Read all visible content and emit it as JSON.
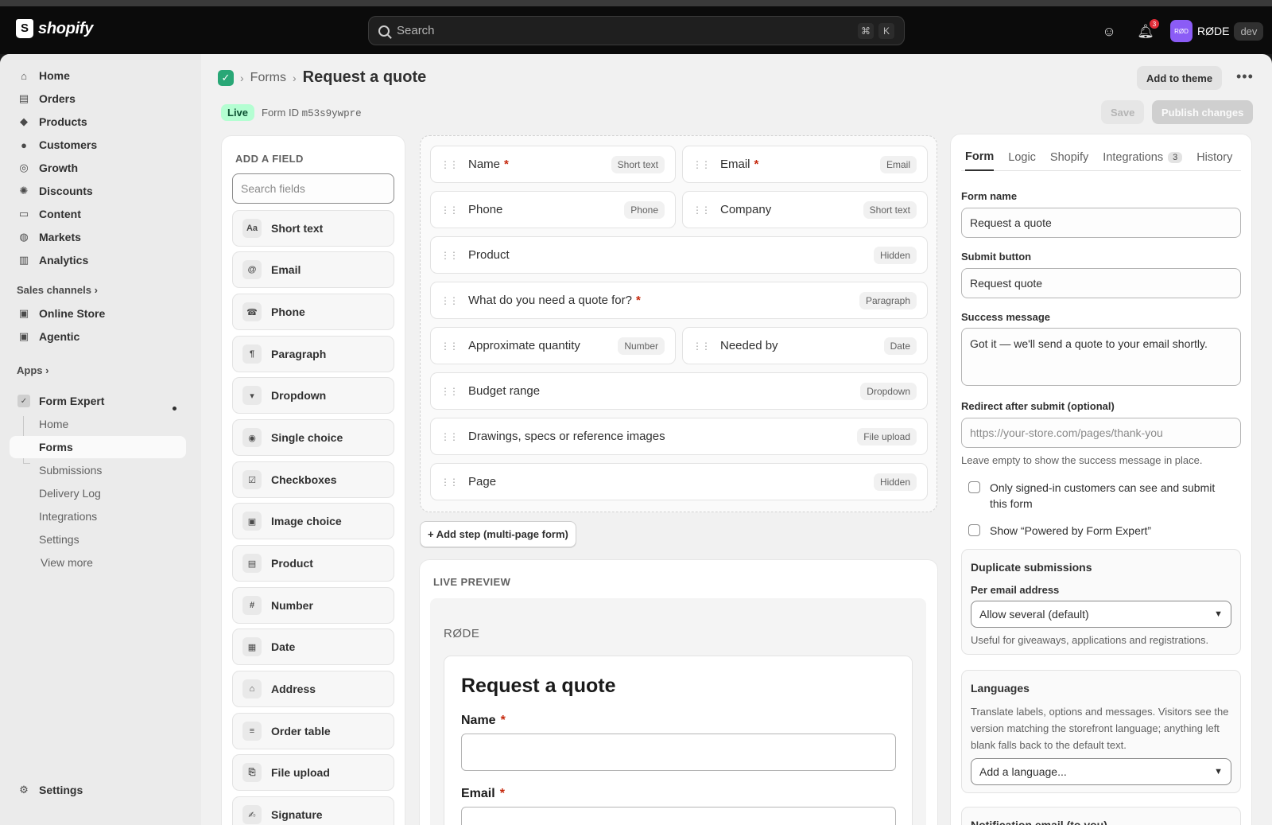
{
  "topbar": {
    "brand": "shopify",
    "search_placeholder": "Search",
    "shortcut_keys": [
      "⌘",
      "K"
    ],
    "notification_count": "3",
    "store_initials": "RØD",
    "store_name": "RØDE",
    "env_badge": "dev"
  },
  "sidebar": {
    "items": [
      {
        "label": "Home",
        "icon": "home-icon"
      },
      {
        "label": "Orders",
        "icon": "inbox-icon"
      },
      {
        "label": "Products",
        "icon": "tag-icon"
      },
      {
        "label": "Customers",
        "icon": "person-icon"
      },
      {
        "label": "Growth",
        "icon": "target-icon"
      },
      {
        "label": "Discounts",
        "icon": "discount-icon"
      },
      {
        "label": "Content",
        "icon": "content-icon"
      },
      {
        "label": "Markets",
        "icon": "globe-icon"
      },
      {
        "label": "Analytics",
        "icon": "bar-chart-icon"
      }
    ],
    "sales_channels_label": "Sales channels",
    "channels": [
      {
        "label": "Online Store",
        "icon": "store-icon"
      },
      {
        "label": "Agentic",
        "icon": "agent-icon"
      }
    ],
    "apps_label": "Apps",
    "app": {
      "label": "Form Expert",
      "icon": "app-check-icon"
    },
    "app_sub": [
      "Home",
      "Forms",
      "Submissions",
      "Delivery Log",
      "Integrations",
      "Settings",
      "View more"
    ],
    "settings_label": "Settings"
  },
  "header": {
    "breadcrumb_parent": "Forms",
    "title": "Request a quote",
    "add_to_theme": "Add to theme",
    "status": "Live",
    "form_id_label": "Form ID",
    "form_id": "m53s9ywpre",
    "save": "Save",
    "publish": "Publish changes"
  },
  "palette": {
    "title": "ADD A FIELD",
    "search_placeholder": "Search fields",
    "items": [
      {
        "glyph": "Aa",
        "label": "Short text"
      },
      {
        "glyph": "@",
        "label": "Email"
      },
      {
        "glyph": "☎",
        "label": "Phone"
      },
      {
        "glyph": "¶",
        "label": "Paragraph"
      },
      {
        "glyph": "▾",
        "label": "Dropdown"
      },
      {
        "glyph": "◉",
        "label": "Single choice"
      },
      {
        "glyph": "☑",
        "label": "Checkboxes"
      },
      {
        "glyph": "▣",
        "label": "Image choice"
      },
      {
        "glyph": "▤",
        "label": "Product"
      },
      {
        "glyph": "#",
        "label": "Number"
      },
      {
        "glyph": "▦",
        "label": "Date"
      },
      {
        "glyph": "⌂",
        "label": "Address"
      },
      {
        "glyph": "≡",
        "label": "Order table"
      },
      {
        "glyph": "⎘",
        "label": "File upload"
      },
      {
        "glyph": "✍",
        "label": "Signature"
      }
    ]
  },
  "canvas": {
    "fields": [
      {
        "label": "Name",
        "required": "*",
        "type": "Short text"
      },
      {
        "label": "Email",
        "required": "*",
        "type": "Email"
      },
      {
        "label": "Phone",
        "required": "",
        "type": "Phone"
      },
      {
        "label": "Company",
        "required": "",
        "type": "Short text"
      },
      {
        "label": "Product",
        "required": "",
        "type": "Hidden"
      },
      {
        "label": "What do you need a quote for?",
        "required": "*",
        "type": "Paragraph"
      },
      {
        "label": "Approximate quantity",
        "required": "",
        "type": "Number"
      },
      {
        "label": "Needed by",
        "required": "",
        "type": "Date"
      },
      {
        "label": "Budget range",
        "required": "",
        "type": "Dropdown"
      },
      {
        "label": "Drawings, specs or reference images",
        "required": "",
        "type": "File upload"
      },
      {
        "label": "Page",
        "required": "",
        "type": "Hidden"
      }
    ],
    "add_step": "+ Add step (multi-page form)"
  },
  "preview": {
    "title": "LIVE PREVIEW",
    "brand": "RØDE",
    "form_title": "Request a quote",
    "name_label": "Name",
    "email_label": "Email",
    "required_mark": "*"
  },
  "settings_panel": {
    "tabs": [
      {
        "label": "Form"
      },
      {
        "label": "Logic"
      },
      {
        "label": "Shopify"
      },
      {
        "label": "Integrations",
        "count": "3"
      },
      {
        "label": "History"
      }
    ],
    "form_name_label": "Form name",
    "form_name": "Request a quote",
    "submit_label": "Submit button",
    "submit_value": "Request quote",
    "success_label": "Success message",
    "success_value": "Got it — we'll send a quote to your email shortly.",
    "redirect_label": "Redirect after submit (optional)",
    "redirect_placeholder": "https://your-store.com/pages/thank-you",
    "redirect_help": "Leave empty to show the success message in place.",
    "checkbox_signed_in": "Only signed-in customers can see and submit this form",
    "checkbox_powered": "Show “Powered by Form Expert”",
    "dup_title": "Duplicate submissions",
    "dup_label": "Per email address",
    "dup_value": "Allow several (default)",
    "dup_help": "Useful for giveaways, applications and registrations.",
    "lang_title": "Languages",
    "lang_help": "Translate labels, options and messages. Visitors see the version matching the storefront language; anything left blank falls back to the default text.",
    "lang_value": "Add a language...",
    "notif_title": "Notification email (to you)"
  }
}
